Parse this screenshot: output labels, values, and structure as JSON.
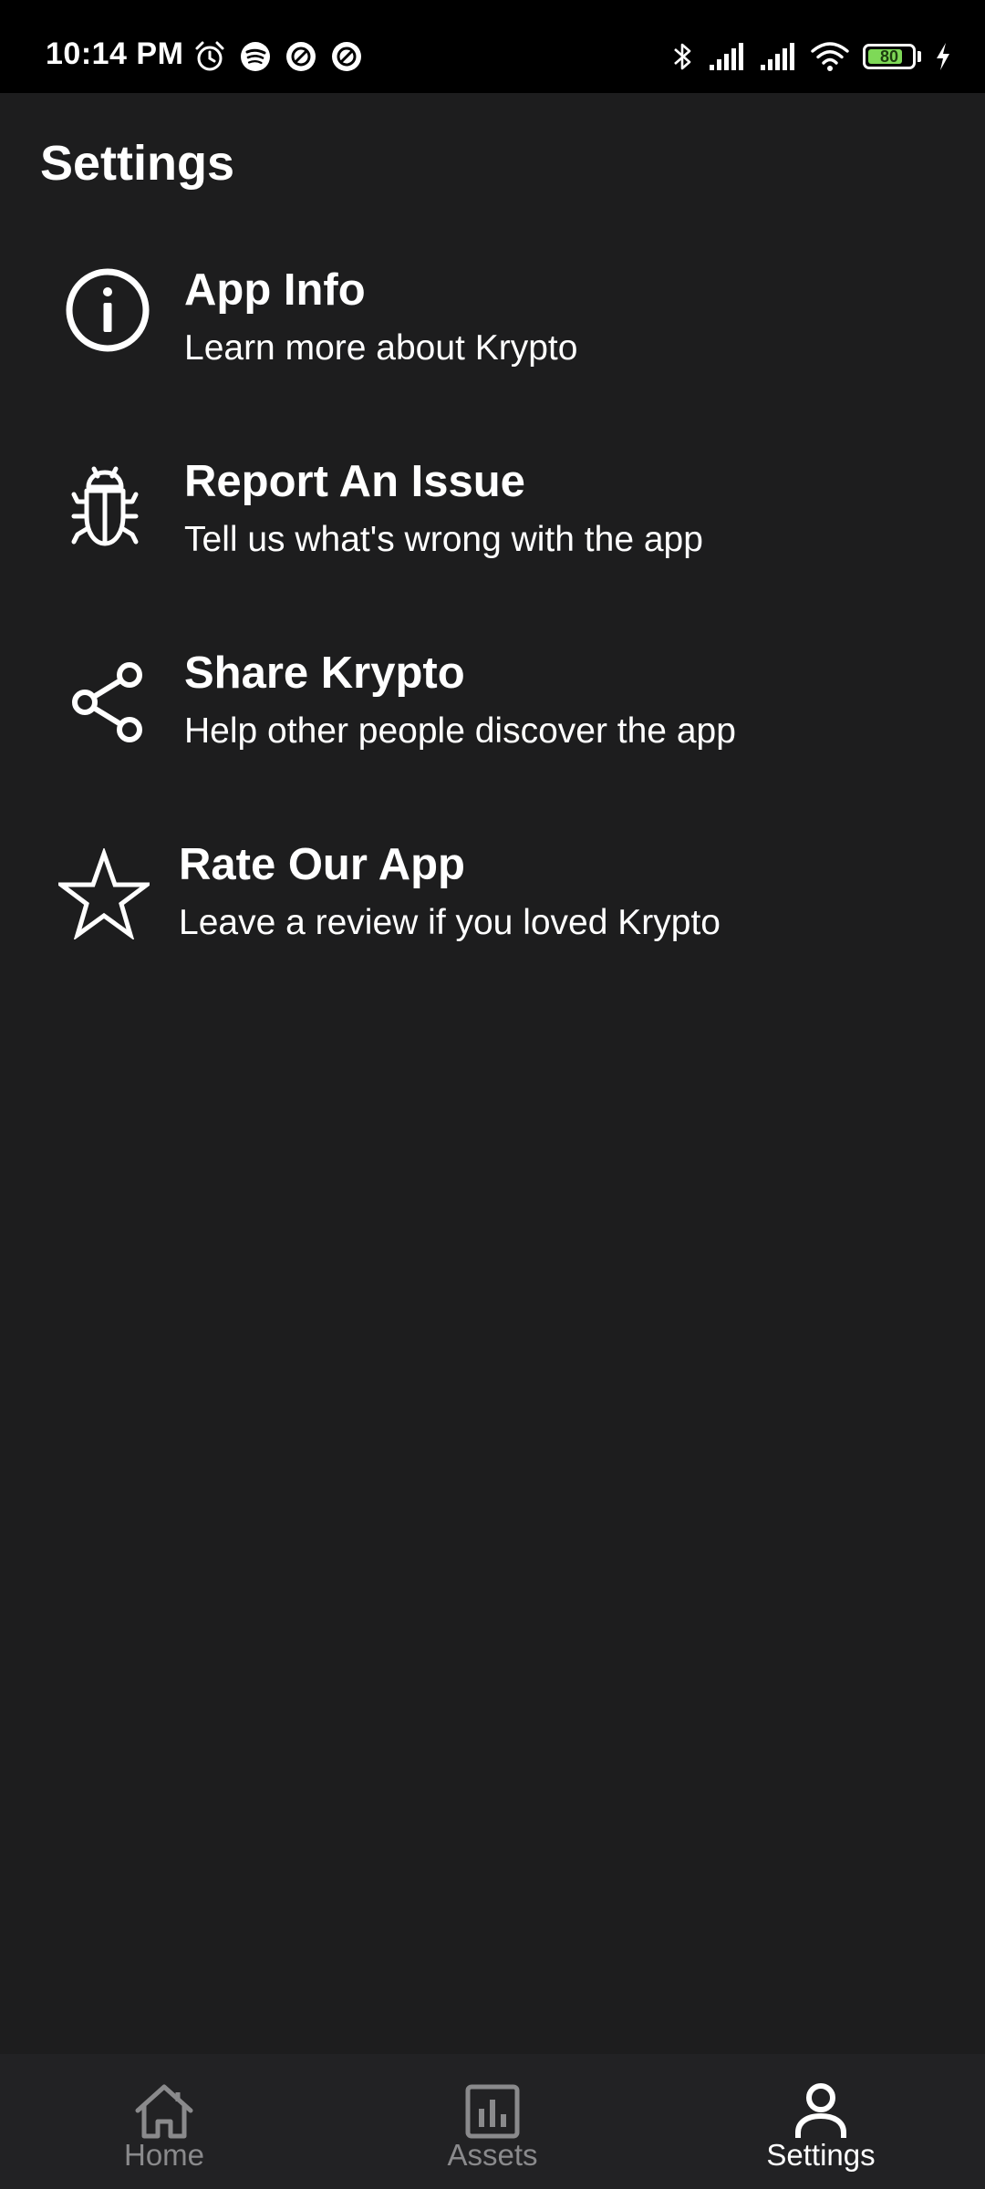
{
  "status_bar": {
    "time": "10:14 PM",
    "left_icons": [
      "alarm-icon",
      "spotify-icon",
      "notification-icon",
      "notification-icon"
    ],
    "right_icons": [
      "bluetooth-icon",
      "signal-icon",
      "signal-icon",
      "wifi-icon"
    ],
    "battery_level": "80",
    "battery_color": "#7ed957"
  },
  "header": {
    "title": "Settings"
  },
  "settings": {
    "items": [
      {
        "title": "App Info",
        "subtitle": "Learn more about Krypto",
        "icon": "info-icon"
      },
      {
        "title": "Report An Issue",
        "subtitle": "Tell us what's wrong with the app",
        "icon": "bug-icon"
      },
      {
        "title": "Share Krypto",
        "subtitle": "Help other people discover the app",
        "icon": "share-icon"
      },
      {
        "title": "Rate Our App",
        "subtitle": "Leave a review if you loved Krypto",
        "icon": "star-icon"
      }
    ]
  },
  "bottom_nav": {
    "items": [
      {
        "label": "Home",
        "icon": "home-icon",
        "active": false
      },
      {
        "label": "Assets",
        "icon": "chart-icon",
        "active": false
      },
      {
        "label": "Settings",
        "icon": "user-icon",
        "active": true
      }
    ]
  },
  "colors": {
    "background": "#1d1d1e",
    "status_bar": "#000000",
    "nav_background": "#222224",
    "inactive": "#8a8a8c",
    "active": "#ffffff"
  }
}
